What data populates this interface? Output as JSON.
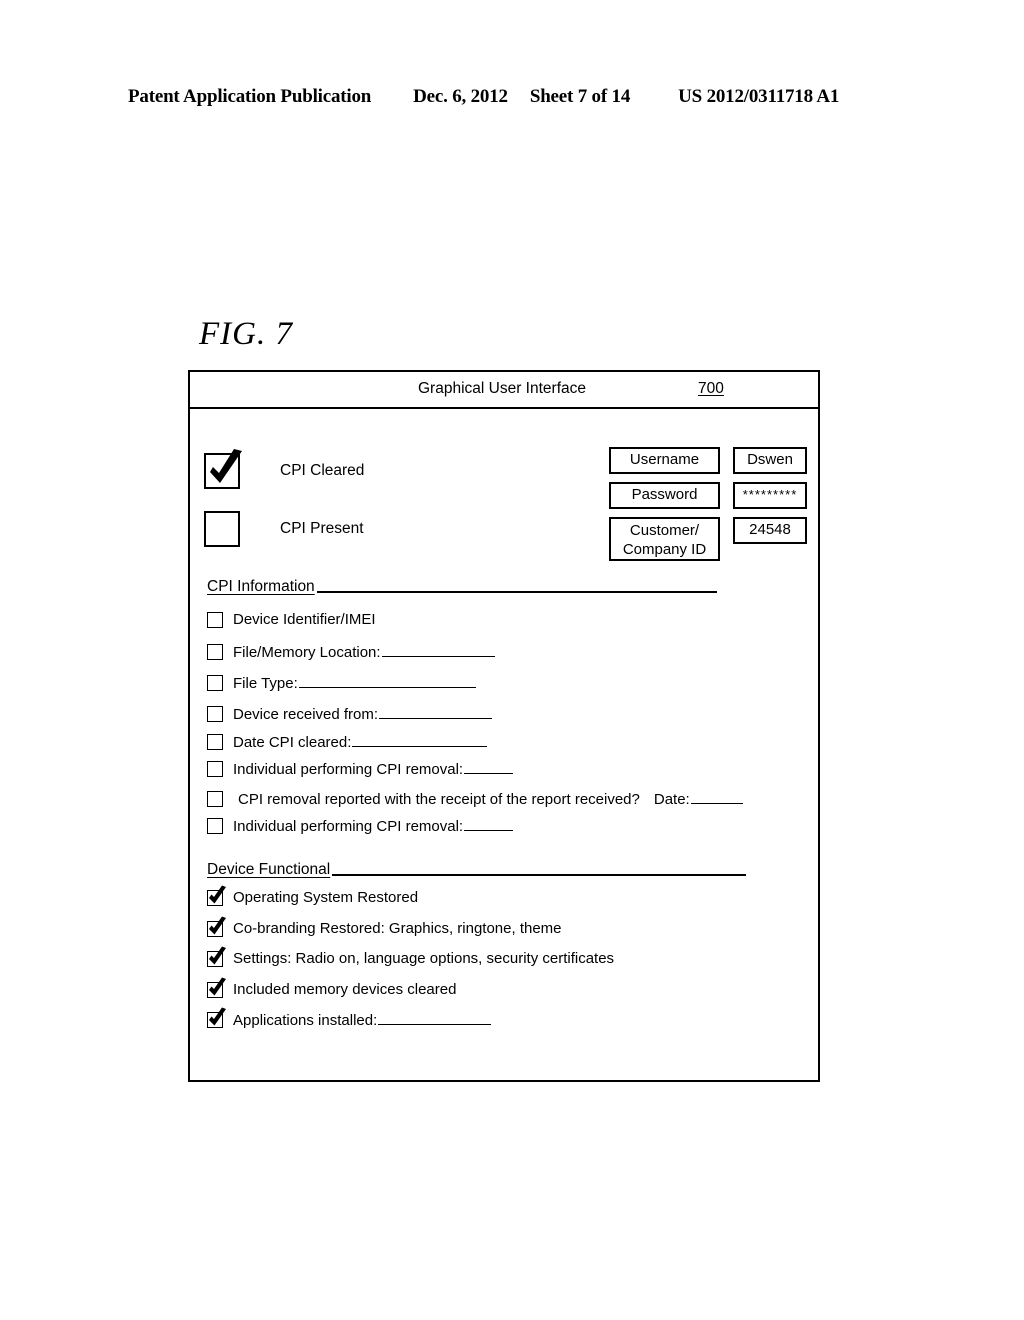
{
  "page_header": {
    "publication": "Patent Application Publication",
    "date": "Dec. 6, 2012",
    "sheet": "Sheet 7 of 14",
    "patent_number": "US 2012/0311718 A1"
  },
  "figure": {
    "label": "FIG. 7"
  },
  "gui": {
    "title": "Graphical User Interface",
    "reference_numeral": "700",
    "status_options": [
      {
        "label": "CPI Cleared",
        "checked": true
      },
      {
        "label": "CPI Present",
        "checked": false
      }
    ],
    "credentials": [
      {
        "label": "Username",
        "value": "Dswen",
        "two_line": false,
        "masked": false
      },
      {
        "label": "Password",
        "value": "*********",
        "two_line": false,
        "masked": true
      },
      {
        "label": "Customer/\nCompany ID",
        "label_line1": "Customer/",
        "label_line2": "Company ID",
        "value": "24548",
        "two_line": true,
        "masked": false
      }
    ],
    "sections": [
      {
        "heading": "CPI Information",
        "items": [
          {
            "text": "Device Identifier/IMEI",
            "checked": false,
            "blank_width": 0
          },
          {
            "text": "File/Memory Location:",
            "checked": false,
            "blank_width": 113
          },
          {
            "text": "File Type:",
            "checked": false,
            "blank_width": 177
          },
          {
            "text": "Device received from:",
            "checked": false,
            "blank_width": 113
          },
          {
            "text": "Date CPI cleared:",
            "checked": false,
            "blank_width": 135
          },
          {
            "text": "Individual performing CPI removal:",
            "checked": false,
            "blank_width": 49
          },
          {
            "text": "CPI removal reported with the receipt of the report received?",
            "checked": false,
            "blank_width": 0,
            "tail_text": "Date:",
            "tail_blank_width": 52
          },
          {
            "text": "Individual performing CPI removal:",
            "checked": false,
            "blank_width": 49
          }
        ]
      },
      {
        "heading": "Device Functional",
        "items": [
          {
            "text": "Operating System Restored",
            "checked": true,
            "blank_width": 0
          },
          {
            "text": "Co-branding Restored:  Graphics, ringtone, theme",
            "checked": true,
            "blank_width": 0
          },
          {
            "text": "Settings:  Radio on, language options, security certificates",
            "checked": true,
            "blank_width": 0
          },
          {
            "text": "Included memory devices cleared",
            "checked": true,
            "blank_width": 0
          },
          {
            "text": "Applications installed:",
            "checked": true,
            "blank_width": 113
          }
        ]
      }
    ]
  }
}
